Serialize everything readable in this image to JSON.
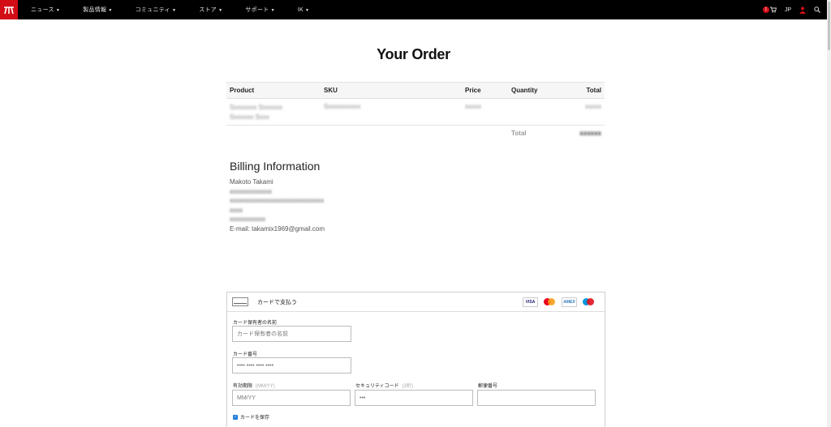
{
  "nav": {
    "items": [
      {
        "label": "ニュース"
      },
      {
        "label": "製品情報"
      },
      {
        "label": "コミュニティ"
      },
      {
        "label": "ストア"
      },
      {
        "label": "サポート"
      },
      {
        "label": "IK"
      }
    ],
    "cart_badge": "1",
    "language": "JP"
  },
  "title": "Your Order",
  "order": {
    "headers": {
      "product": "Product",
      "sku": "SKU",
      "price": "Price",
      "quantity": "Quantity",
      "total": "Total"
    },
    "row": {
      "product_line1": "Sxxxxxxx Sxxxxxx",
      "product_line2": "Sxxxxxx Sxxx",
      "sku": "Sxxxxxxxxxx",
      "price": "xxxxx",
      "total": "xxxxx"
    },
    "total_label": "Total",
    "total_value": "xxxxxx"
  },
  "billing": {
    "heading": "Billing Information",
    "name": "Makoto Takami",
    "line1": "xxxxxxxxxxxxx",
    "line2": "xxxxxxxxxxxxxxxxxxxxxxxxxxxxx",
    "line3": "xxxx",
    "line4": "xxxxxxxxxxx",
    "email": "E-mail: takamix1969@gmail.com"
  },
  "payment": {
    "title": "カードで支払う",
    "brands": {
      "visa": "VISA",
      "amex": "AMEX"
    },
    "holder_label": "カード保有者の名前",
    "holder_placeholder": "カード保有者の名前",
    "number_label": "カード番号",
    "number_placeholder": "•••• •••• •••• ••••",
    "expiry_label": "有効期限",
    "expiry_hint": "(MM/YY)",
    "expiry_placeholder": "MM/YY",
    "cvc_label": "セキュリティコード",
    "cvc_hint": "(3桁)",
    "cvc_placeholder": "•••",
    "zip_label": "郵便番号",
    "zip_placeholder": "",
    "save_label": "カードを保存"
  }
}
